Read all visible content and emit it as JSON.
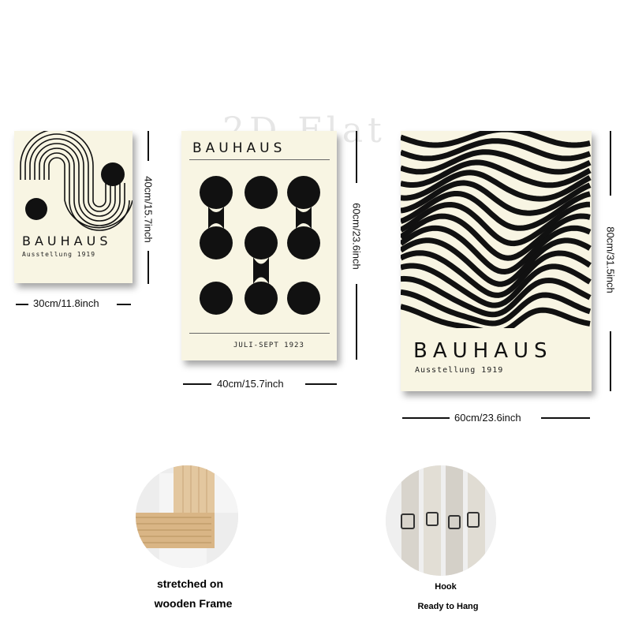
{
  "watermark": "2D Flat",
  "posters": [
    {
      "brand": "BAUHAUS",
      "subtitle": "Ausstellung 1919",
      "width_label": "30cm/11.8inch",
      "height_label": "40cm/15.7inch"
    },
    {
      "brand": "BAUHAUS",
      "subtitle": "JULI-SEPT 1923",
      "width_label": "40cm/15.7inch",
      "height_label": "60cm/23.6inch"
    },
    {
      "brand": "BAUHAUS",
      "subtitle": "Ausstellung 1919",
      "width_label": "60cm/23.6inch",
      "height_label": "80cm/31.5inch"
    }
  ],
  "features": [
    {
      "line1": "stretched on",
      "line2": "wooden Frame"
    },
    {
      "line1": "Hook",
      "line2": "Ready to Hang"
    }
  ]
}
